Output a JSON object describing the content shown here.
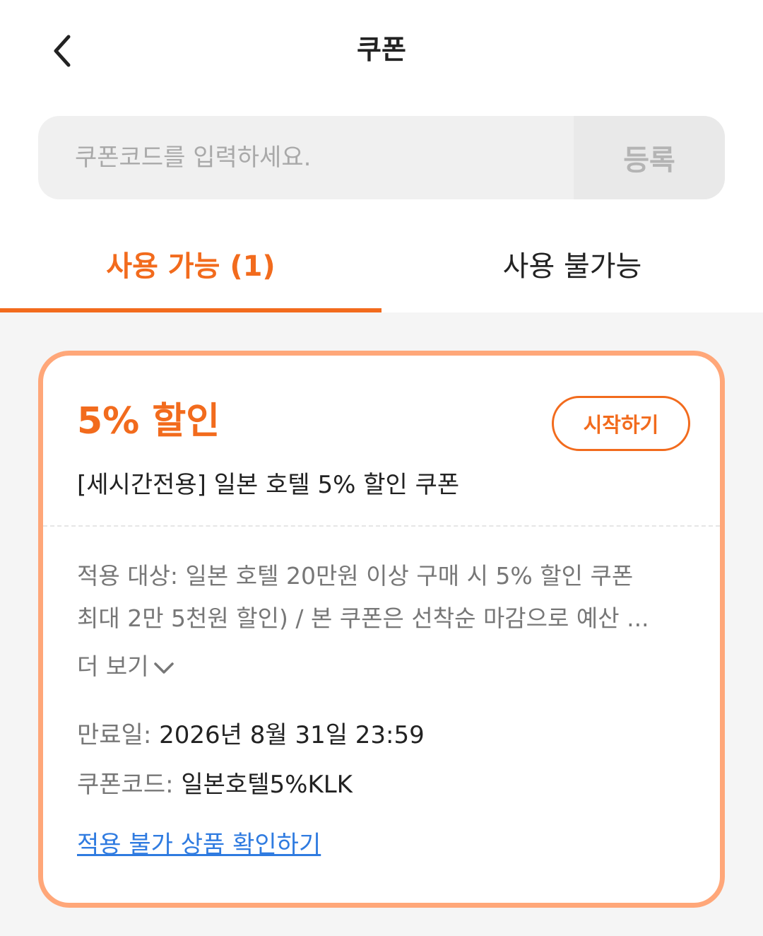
{
  "header": {
    "title": "쿠폰",
    "back_icon": "chevron-left-icon"
  },
  "code_entry": {
    "placeholder": "쿠폰코드를 입력하세요.",
    "value": "",
    "register_label": "등록"
  },
  "tabs": [
    {
      "label": "사용 가능 (1)",
      "active": true
    },
    {
      "label": "사용 불가능",
      "active": false
    }
  ],
  "colors": {
    "accent": "#f26b1d",
    "card_border": "#ffa779",
    "link": "#2f7be0"
  },
  "coupon": {
    "headline": "5% 할인",
    "start_label": "시작하기",
    "subtitle": "[세시간전용] 일본 호텔 5% 할인 쿠폰",
    "description_line1": "적용 대상: 일본 호텔 20만원 이상 구매 시 5% 할인 쿠폰",
    "description_line2": "최대 2만 5천원 할인) / 본 쿠폰은 선착순 마감으로 예산 ...",
    "more_label": "더 보기",
    "more_icon": "chevron-down-icon",
    "expiry_label": "만료일:",
    "expiry_value": "2026년 8월 31일 23:59",
    "code_label": "쿠폰코드:",
    "code_value": "일본호텔5%KLK",
    "excluded_link": "적용 불가 상품 확인하기"
  }
}
